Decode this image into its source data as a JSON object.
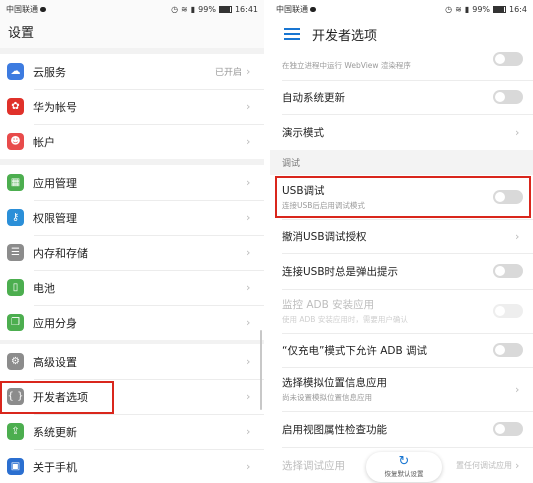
{
  "status_left": {
    "carrier": "中国联通",
    "battery": "99%",
    "time": "16:41"
  },
  "status_right": {
    "carrier": "中国联通",
    "battery": "99%",
    "time": "16:4"
  },
  "settings": {
    "title": "设置",
    "items": [
      {
        "label": "云服务",
        "value": "已开启",
        "icon": "cloud-icon",
        "color": "#3d7be0"
      },
      {
        "label": "华为帐号",
        "icon": "huawei-icon",
        "color": "#e0312a"
      },
      {
        "label": "帐户",
        "icon": "account-icon",
        "color": "#e84b4b"
      },
      {
        "label": "应用管理",
        "icon": "apps-grid-icon",
        "color": "#4cae4f"
      },
      {
        "label": "权限管理",
        "icon": "key-icon",
        "color": "#2b8fd8"
      },
      {
        "label": "内存和存储",
        "icon": "storage-icon",
        "color": "#8c8c8c"
      },
      {
        "label": "电池",
        "icon": "battery-icon",
        "color": "#4cae4f"
      },
      {
        "label": "应用分身",
        "icon": "app-twin-icon",
        "color": "#4cae4f"
      },
      {
        "label": "高级设置",
        "icon": "gear-icon",
        "color": "#8c8c8c"
      },
      {
        "label": "开发者选项",
        "icon": "braces-icon",
        "color": "#8c8c8c"
      },
      {
        "label": "系统更新",
        "icon": "system-update-icon",
        "color": "#4cae4f"
      },
      {
        "label": "关于手机",
        "icon": "phone-info-icon",
        "color": "#2b6fd0"
      }
    ]
  },
  "developer": {
    "title": "开发者选项",
    "items": [
      {
        "title": "",
        "subtitle": "在独立进程中运行 WebView 渲染程序"
      },
      {
        "title": "自动系统更新"
      },
      {
        "title": "演示模式"
      },
      {
        "section": "调试"
      },
      {
        "title": "USB调试",
        "subtitle": "连接USB后启用调试模式"
      },
      {
        "title": "撤消USB调试授权"
      },
      {
        "title": "连接USB时总是弹出提示"
      },
      {
        "title": "监控 ADB 安装应用",
        "subtitle": "使用 ADB 安装应用时，需要用户确认"
      },
      {
        "title": "“仅充电”模式下允许 ADB 调试"
      },
      {
        "title": "选择模拟位置信息应用",
        "subtitle": "尚未设置模拟位置信息应用"
      },
      {
        "title": "启用视图属性检查功能"
      },
      {
        "title": "选择调试应用",
        "trail": "置任何调试应用"
      }
    ],
    "restore_label": "恢复默认设置"
  },
  "colors": {
    "highlight": "#d9261c",
    "accent": "#1976d2"
  }
}
